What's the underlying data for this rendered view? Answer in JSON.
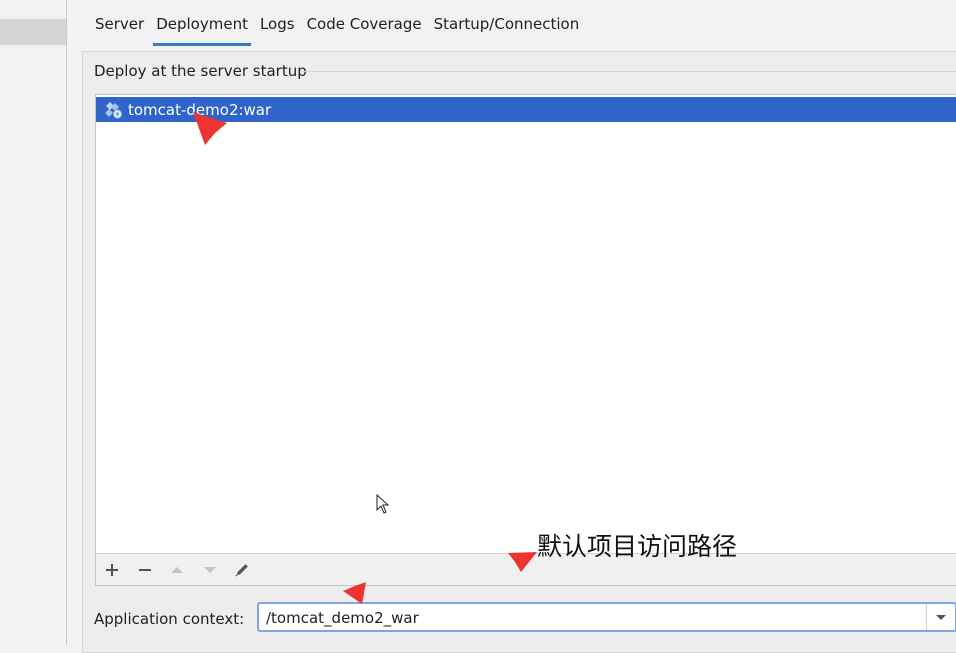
{
  "tabs": [
    {
      "label": "Server"
    },
    {
      "label": "Deployment",
      "active": true
    },
    {
      "label": "Logs"
    },
    {
      "label": "Code Coverage"
    },
    {
      "label": "Startup/Connection"
    }
  ],
  "deployment": {
    "group_title": "Deploy at the server startup",
    "artifacts": [
      {
        "name": "tomcat-demo2:war",
        "icon": "artifact-icon",
        "selected": true
      }
    ],
    "toolbar": {
      "add_icon": "plus-icon",
      "remove_icon": "minus-icon",
      "move_up_icon": "arrow-up-icon",
      "move_down_icon": "arrow-down-icon",
      "edit_icon": "pencil-icon"
    },
    "application_context_label": "Application context:",
    "application_context_value": "/tomcat_demo2_war"
  },
  "annotation": {
    "text": "默认项目访问路径",
    "arrow_color": "#ee3333"
  },
  "colors": {
    "selection": "#2f65ca",
    "tab_underline": "#3c7ac6",
    "focus_border": "#7fa7e6"
  }
}
